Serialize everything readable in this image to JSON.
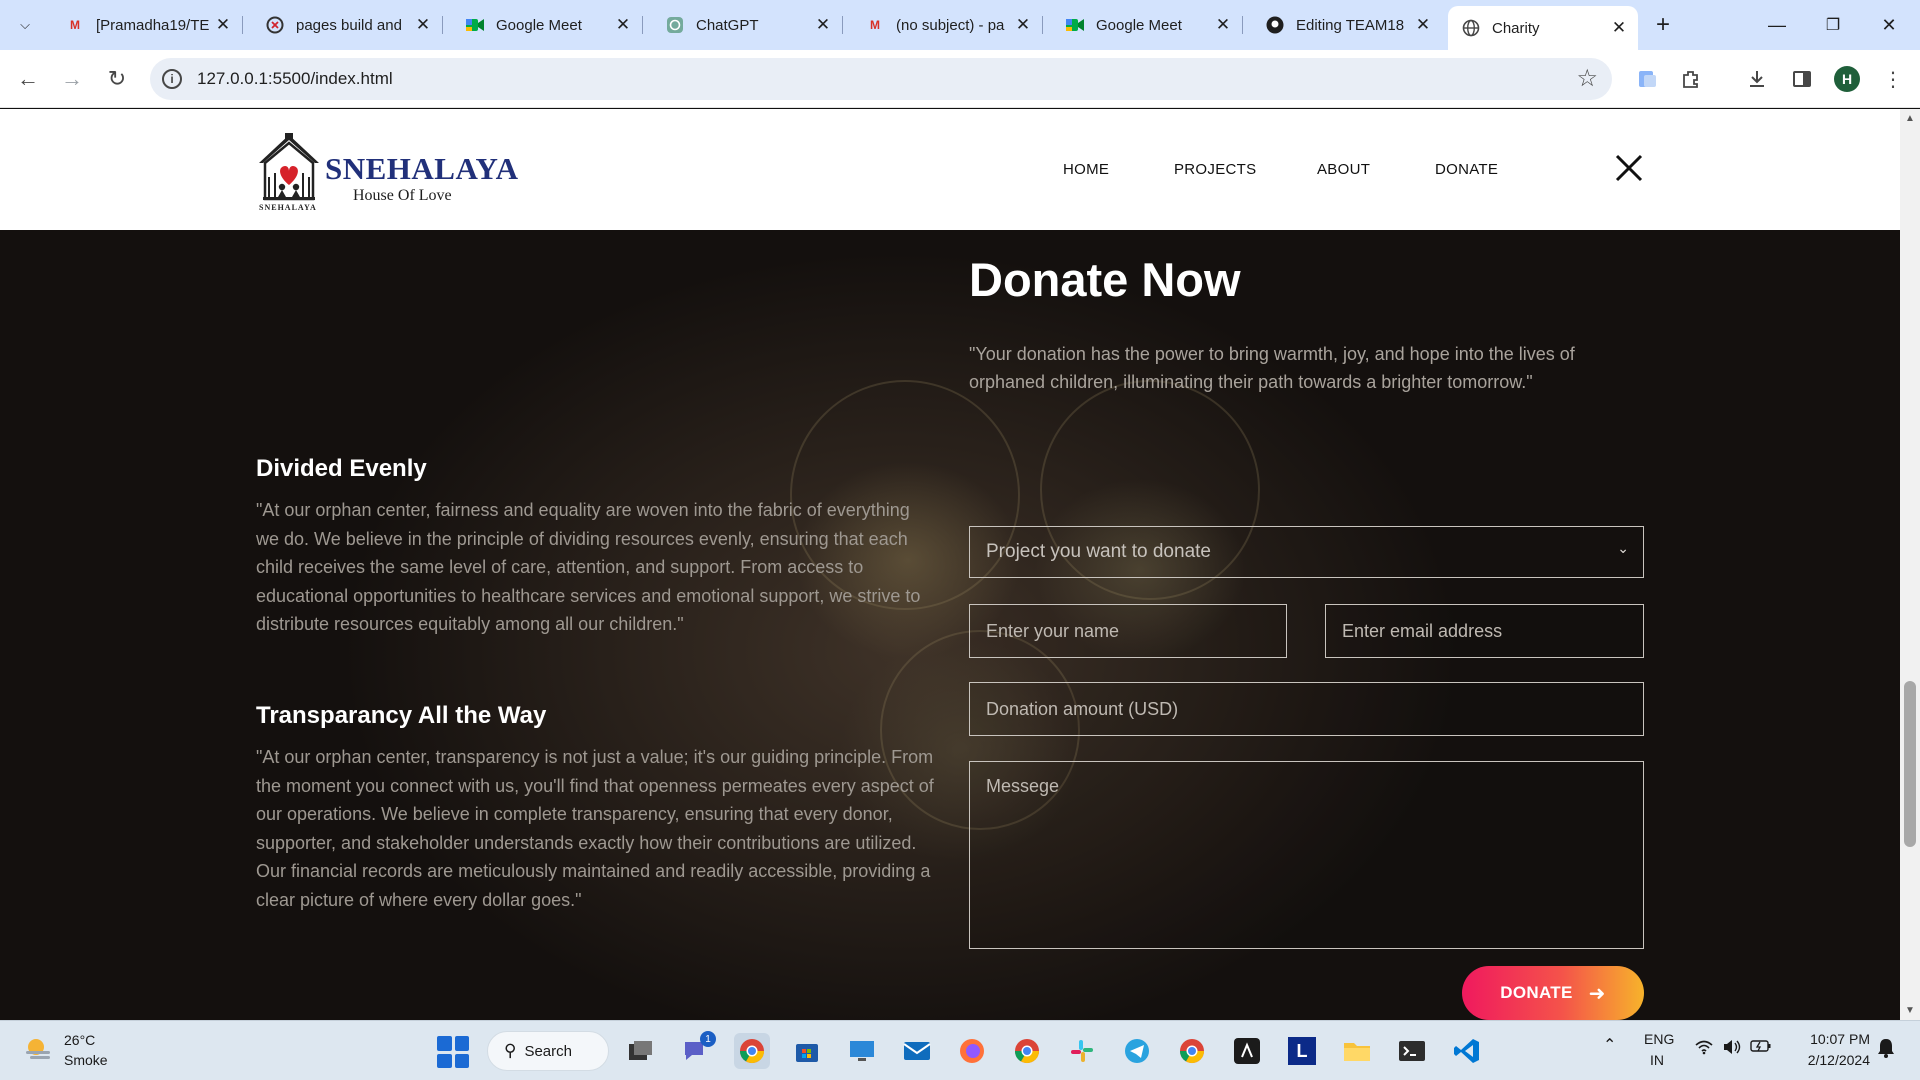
{
  "browser": {
    "tabs": [
      {
        "title": "[Pramadha19/TE",
        "icon": "gmail-icon",
        "active": false
      },
      {
        "title": "pages build and",
        "icon": "github-actions-icon",
        "active": false
      },
      {
        "title": "Google Meet",
        "icon": "google-meet-icon",
        "active": false
      },
      {
        "title": "ChatGPT",
        "icon": "chatgpt-icon",
        "active": false
      },
      {
        "title": "(no subject) - pa",
        "icon": "gmail-icon",
        "active": false
      },
      {
        "title": "Google Meet",
        "icon": "google-meet-icon",
        "active": false
      },
      {
        "title": "Editing TEAM18",
        "icon": "github-icon",
        "active": false
      },
      {
        "title": "Charity",
        "icon": "globe-icon",
        "active": true
      }
    ],
    "url": "127.0.0.1:5500/index.html",
    "profile_initial": "H"
  },
  "site": {
    "logo": {
      "brand": "SNEHALAYA",
      "tagline": "House Of Love",
      "mini": "SNEHALAYA"
    },
    "nav": [
      {
        "label": "HOME"
      },
      {
        "label": "PROJECTS"
      },
      {
        "label": "ABOUT"
      },
      {
        "label": "DONATE"
      }
    ]
  },
  "donate_section": {
    "title": "Donate Now",
    "quote": "\"Your donation has the power to bring warmth, joy, and hope into the lives of orphaned children, illuminating their path towards a brighter tomorrow.\"",
    "features": [
      {
        "title": "Divided Evenly",
        "text": "\"At our orphan center, fairness and equality are woven into the fabric of everything we do. We believe in the principle of dividing resources evenly, ensuring that each child receives the same level of care, attention, and support. From access to educational opportunities to healthcare services and emotional support, we strive to distribute resources equitably among all our children.\""
      },
      {
        "title": "Transparancy All the Way",
        "text": "\"At our orphan center, transparency is not just a value; it's our guiding principle. From the moment you connect with us, you'll find that openness permeates every aspect of our operations. We believe in complete transparency, ensuring that every donor, supporter, and stakeholder understands exactly how their contributions are utilized. Our financial records are meticulously maintained and readily accessible, providing a clear picture of where every dollar goes.\""
      }
    ],
    "form": {
      "project_select": "Project you want to donate",
      "name_placeholder": "Enter your name",
      "email_placeholder": "Enter email address",
      "amount_placeholder": "Donation amount (USD)",
      "message_placeholder": "Messege",
      "submit_label": "DONATE"
    }
  },
  "taskbar": {
    "weather": {
      "temp": "26°C",
      "desc": "Smoke"
    },
    "search_label": "Search",
    "chat_badge": "1",
    "lang_top": "ENG",
    "lang_bottom": "IN",
    "time": "10:07 PM",
    "date": "2/12/2024",
    "vlc_letter": "L"
  },
  "colors": {
    "brand_navy": "#21307a",
    "donate_gradient_start": "#f0195e",
    "donate_gradient_end": "#f7b32b",
    "tab_strip": "#d3e3fd"
  }
}
